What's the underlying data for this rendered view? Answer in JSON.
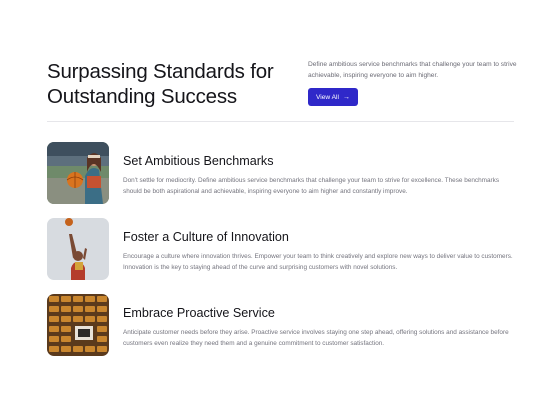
{
  "header": {
    "title": "Surpassing Standards for Outstanding Success",
    "description": "Define ambitious service benchmarks that challenge your team to strive achievable, inspiring everyone to aim higher.",
    "cta_label": "View All",
    "cta_icon": "arrow-right-icon",
    "accent_color": "#2f28c9"
  },
  "features": [
    {
      "title": "Set Ambitious Benchmarks",
      "description": "Don't settle for mediocrity. Define ambitious service benchmarks that challenge your team to strive for excellence. These benchmarks should be both aspirational and achievable, inspiring everyone to aim higher and constantly improve."
    },
    {
      "title": "Foster a Culture of Innovation",
      "description": "Encourage a culture where innovation thrives. Empower your team to think creatively and explore new ways to deliver value to customers. Innovation is the key to staying ahead of the curve and surprising customers with novel solutions."
    },
    {
      "title": "Embrace Proactive Service",
      "description": "Anticipate customer needs before they arise. Proactive service involves staying one step ahead, offering solutions and assistance before customers even realize they need them and a genuine commitment to customer satisfaction."
    }
  ]
}
